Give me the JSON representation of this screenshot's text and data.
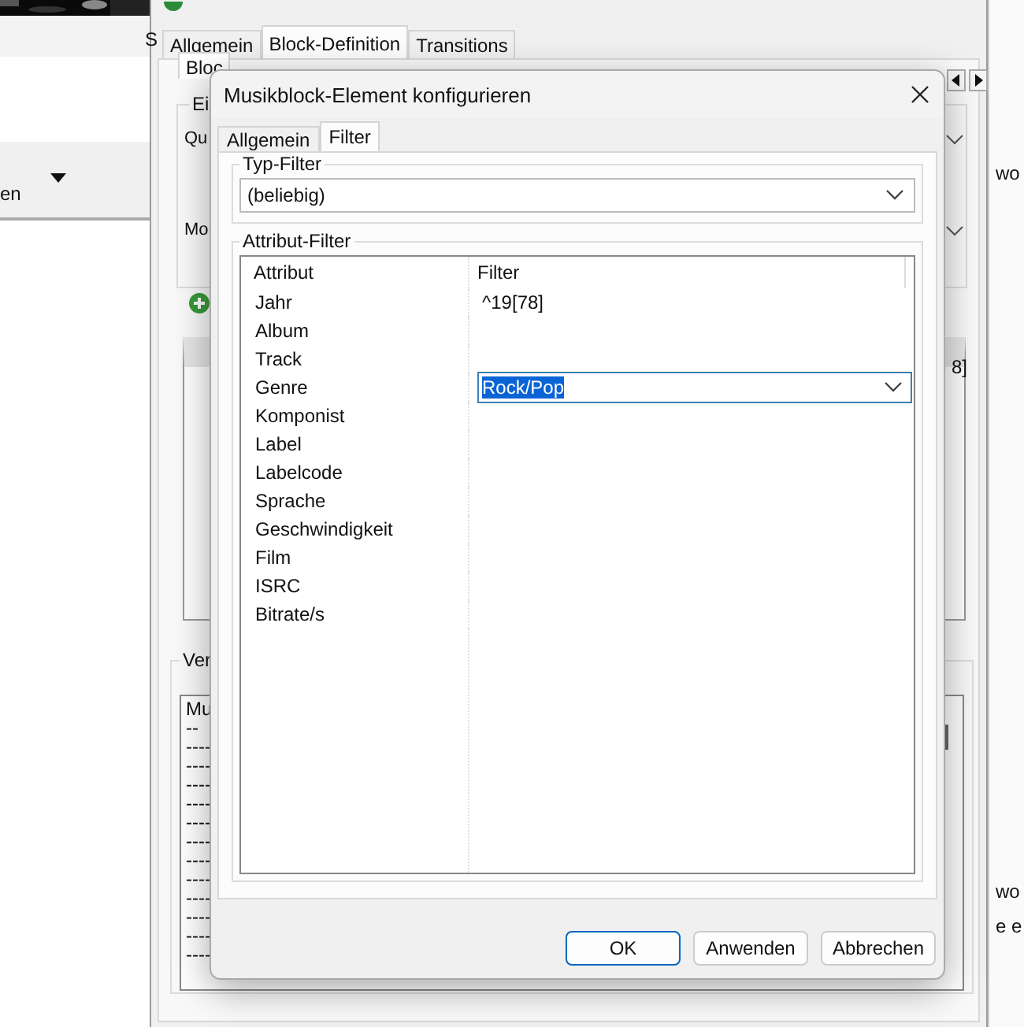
{
  "left_app": {
    "text": "en"
  },
  "background_window": {
    "tabs": [
      {
        "label": "Allgemein",
        "selected": false
      },
      {
        "label": "Block-Definition",
        "selected": true
      },
      {
        "label": "Transitions",
        "selected": false
      }
    ],
    "side_tab": "S",
    "inner_tab": "Bloc",
    "group_label": "Ei",
    "field_labels": [
      "Qu",
      "Mo"
    ],
    "table_cell": "8]",
    "log_group": "Ver",
    "log_lines": [
      "Mu",
      "--",
      "----",
      "----",
      "----",
      "----",
      "----",
      "----",
      "----",
      "----",
      "----",
      "----",
      "----",
      "----"
    ]
  },
  "right_app": {
    "texts": [
      "wo",
      "wo",
      "e e"
    ]
  },
  "dialog": {
    "title": "Musikblock-Element konfigurieren",
    "tabs": [
      {
        "label": "Allgemein",
        "selected": false
      },
      {
        "label": "Filter",
        "selected": true
      }
    ],
    "typ_filter": {
      "label": "Typ-Filter",
      "value": "(beliebig)"
    },
    "attribut_filter": {
      "label": "Attribut-Filter",
      "columns": [
        "Attribut",
        "Filter"
      ],
      "rows": [
        {
          "attribut": "Jahr",
          "kind": "text",
          "filter": "^19[78]"
        },
        {
          "attribut": "Album",
          "kind": "empty"
        },
        {
          "attribut": "Track",
          "kind": "empty"
        },
        {
          "attribut": "Genre",
          "kind": "combo",
          "filter": "Rock/Pop",
          "text_selected": true
        },
        {
          "attribut": "Komponist",
          "kind": "empty"
        },
        {
          "attribut": "Label",
          "kind": "empty"
        },
        {
          "attribut": "Labelcode",
          "kind": "empty"
        },
        {
          "attribut": "Sprache",
          "kind": "empty"
        },
        {
          "attribut": "Geschwindigkeit",
          "kind": "empty"
        },
        {
          "attribut": "Film",
          "kind": "empty"
        },
        {
          "attribut": "ISRC",
          "kind": "empty"
        },
        {
          "attribut": "Bitrate/s",
          "kind": "empty"
        }
      ]
    },
    "buttons": [
      {
        "label": "OK",
        "default": true
      },
      {
        "label": "Anwenden",
        "default": false
      },
      {
        "label": "Abbrechen",
        "default": false
      }
    ]
  }
}
